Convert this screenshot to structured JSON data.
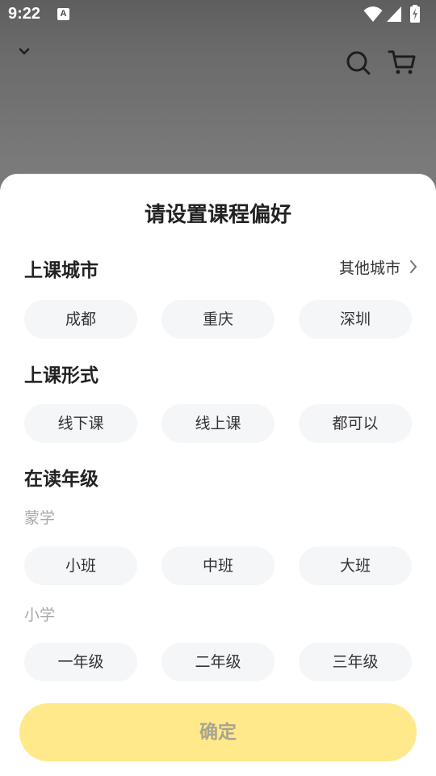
{
  "status_bar": {
    "time": "9:22",
    "notification_icon": "A",
    "icons": [
      "wifi-icon",
      "signal-icon",
      "battery-charging-icon"
    ]
  },
  "header": {
    "icons": [
      "chevron-down-icon",
      "search-icon",
      "cart-icon"
    ]
  },
  "sheet": {
    "title": "请设置课程偏好",
    "city": {
      "title": "上课城市",
      "other_label": "其他城市",
      "options": [
        "成都",
        "重庆",
        "深圳"
      ]
    },
    "format": {
      "title": "上课形式",
      "options": [
        "线下课",
        "线上课",
        "都可以"
      ]
    },
    "grade": {
      "title": "在读年级",
      "groups": [
        {
          "label": "蒙学",
          "options": [
            "小班",
            "中班",
            "大班"
          ]
        },
        {
          "label": "小学",
          "options": [
            "一年级",
            "二年级",
            "三年级"
          ]
        }
      ]
    },
    "confirm_label": "确定"
  },
  "colors": {
    "confirm_bg": "#ffe98a",
    "confirm_text": "#a9a490",
    "chip_bg": "#f5f6f8",
    "overlay": "#7a7a7a"
  }
}
